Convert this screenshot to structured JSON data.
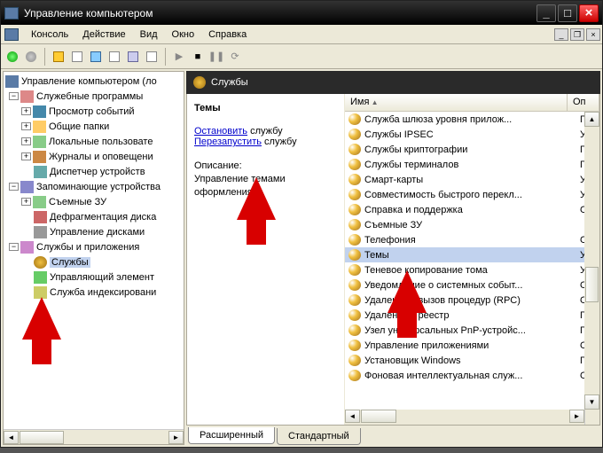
{
  "titlebar": {
    "title": "Управление компьютером"
  },
  "menu": {
    "console": "Консоль",
    "action": "Действие",
    "view": "Вид",
    "window": "Окно",
    "help": "Справка"
  },
  "tree": {
    "root": "Управление компьютером (ло",
    "g1": "Служебные программы",
    "g1_1": "Просмотр событий",
    "g1_2": "Общие папки",
    "g1_3": "Локальные пользовате",
    "g1_4": "Журналы и оповещени",
    "g1_5": "Диспетчер устройств",
    "g2": "Запоминающие устройства",
    "g2_1": "Съемные ЗУ",
    "g2_2": "Дефрагментация диска",
    "g2_3": "Управление дисками",
    "g3": "Службы и приложения",
    "g3_1": "Службы",
    "g3_2": "Управляющий элемент",
    "g3_3": "Служба индексировани"
  },
  "panel": {
    "header": "Службы"
  },
  "detail": {
    "title": "Темы",
    "stop_link": "Остановить",
    "stop_sfx": " службу",
    "restart_link": "Перезапустить",
    "restart_sfx": " службу",
    "desc_label": "Описание:",
    "desc": "Управление темами оформления."
  },
  "list": {
    "col_name": "Имя",
    "col2": "Оп",
    "rows": [
      {
        "n": "Служба шлюза уровня прилож...",
        "c": "По"
      },
      {
        "n": "Службы IPSEC",
        "c": "Уп"
      },
      {
        "n": "Службы криптографии",
        "c": "Пр"
      },
      {
        "n": "Службы терминалов",
        "c": "Пр"
      },
      {
        "n": "Смарт-карты",
        "c": "Уп"
      },
      {
        "n": "Совместимость быстрого перекл...",
        "c": "Уп"
      },
      {
        "n": "Справка и поддержка",
        "c": "Об"
      },
      {
        "n": "Съемные ЗУ",
        "c": ""
      },
      {
        "n": "Телефония",
        "c": "Об"
      },
      {
        "n": "Темы",
        "c": "Уп"
      },
      {
        "n": "Теневое копирование тома",
        "c": "Уп"
      },
      {
        "n": "Уведомление о системных событ...",
        "c": "От"
      },
      {
        "n": "Удаленный вызов процедур (RPC)",
        "c": "Об"
      },
      {
        "n": "Удаленный реестр",
        "c": "По"
      },
      {
        "n": "Узел универсальных PnP-устройс...",
        "c": "Пр"
      },
      {
        "n": "Управление приложениями",
        "c": "Об"
      },
      {
        "n": "Установщик Windows",
        "c": "По"
      },
      {
        "n": "Фоновая интеллектуальная служ...",
        "c": "Об"
      }
    ]
  },
  "tabs": {
    "ext": "Расширенный",
    "std": "Стандартный"
  }
}
